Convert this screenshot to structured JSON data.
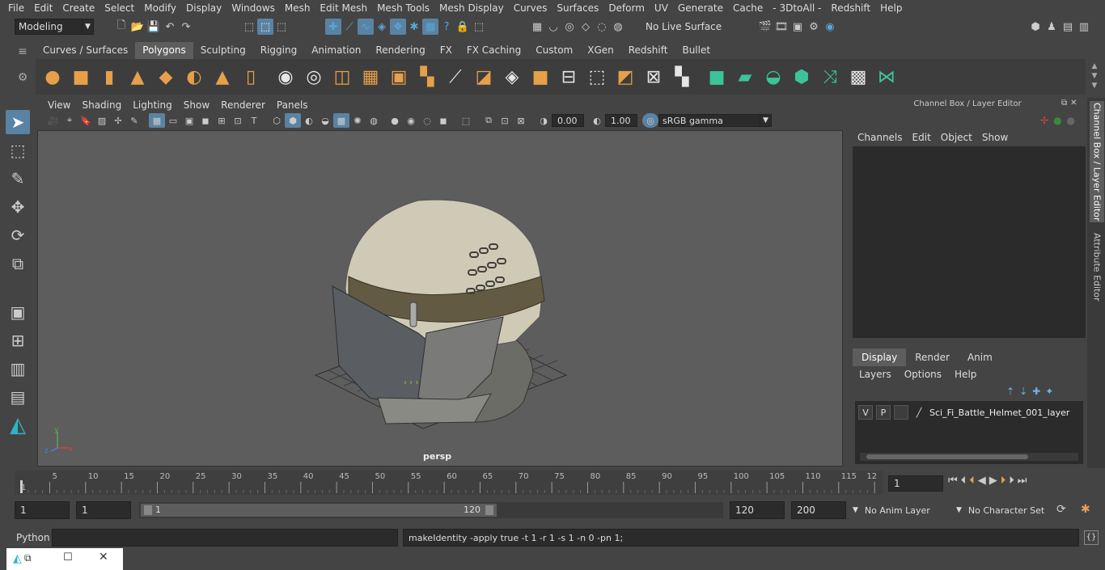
{
  "menubar": [
    "File",
    "Edit",
    "Create",
    "Select",
    "Modify",
    "Display",
    "Windows",
    "Mesh",
    "Edit Mesh",
    "Mesh Tools",
    "Mesh Display",
    "Curves",
    "Surfaces",
    "Deform",
    "UV",
    "Generate",
    "Cache",
    "- 3DtoAll -",
    "Redshift",
    "Help"
  ],
  "status": {
    "mode": "Modeling",
    "live_surface": "No Live Surface"
  },
  "shelf_tabs": [
    "Curves / Surfaces",
    "Polygons",
    "Sculpting",
    "Rigging",
    "Animation",
    "Rendering",
    "FX",
    "FX Caching",
    "Custom",
    "XGen",
    "Redshift",
    "Bullet"
  ],
  "shelf_active": "Polygons",
  "viewport": {
    "menu": [
      "View",
      "Shading",
      "Lighting",
      "Show",
      "Renderer",
      "Panels"
    ],
    "exposure": "0.00",
    "gamma": "1.00",
    "color_space": "sRGB gamma",
    "camera_label": "persp"
  },
  "channel_box": {
    "title": "Channel Box / Layer Editor",
    "menu": [
      "Channels",
      "Edit",
      "Object",
      "Show"
    ]
  },
  "side_tabs": {
    "channel_box": "Channel Box / Layer Editor",
    "attribute_editor": "Attribute Editor"
  },
  "layer_editor": {
    "tabs": [
      "Display",
      "Render",
      "Anim"
    ],
    "menu": [
      "Layers",
      "Options",
      "Help"
    ],
    "layer": {
      "visible": "V",
      "playback": "P",
      "name": "Sci_Fi_Battle_Helmet_001_layer"
    }
  },
  "timeline": {
    "ticks": [
      "1",
      "5",
      "10",
      "15",
      "20",
      "25",
      "30",
      "35",
      "40",
      "45",
      "50",
      "55",
      "60",
      "65",
      "70",
      "75",
      "80",
      "85",
      "90",
      "95",
      "100",
      "105",
      "110",
      "115",
      "12"
    ],
    "current_frame": "1"
  },
  "range": {
    "start": "1",
    "playback_start": "1",
    "slider_start": "1",
    "slider_end": "120",
    "playback_end": "120",
    "end": "200",
    "anim_layer": "No Anim Layer",
    "character_set": "No Character Set"
  },
  "command": {
    "language": "Python",
    "input": "",
    "result": "makeIdentity -apply true -t 1 -r 1 -s 1 -n 0 -pn 1;"
  },
  "axis": {
    "y": "y",
    "z": "z",
    "x": "x"
  }
}
